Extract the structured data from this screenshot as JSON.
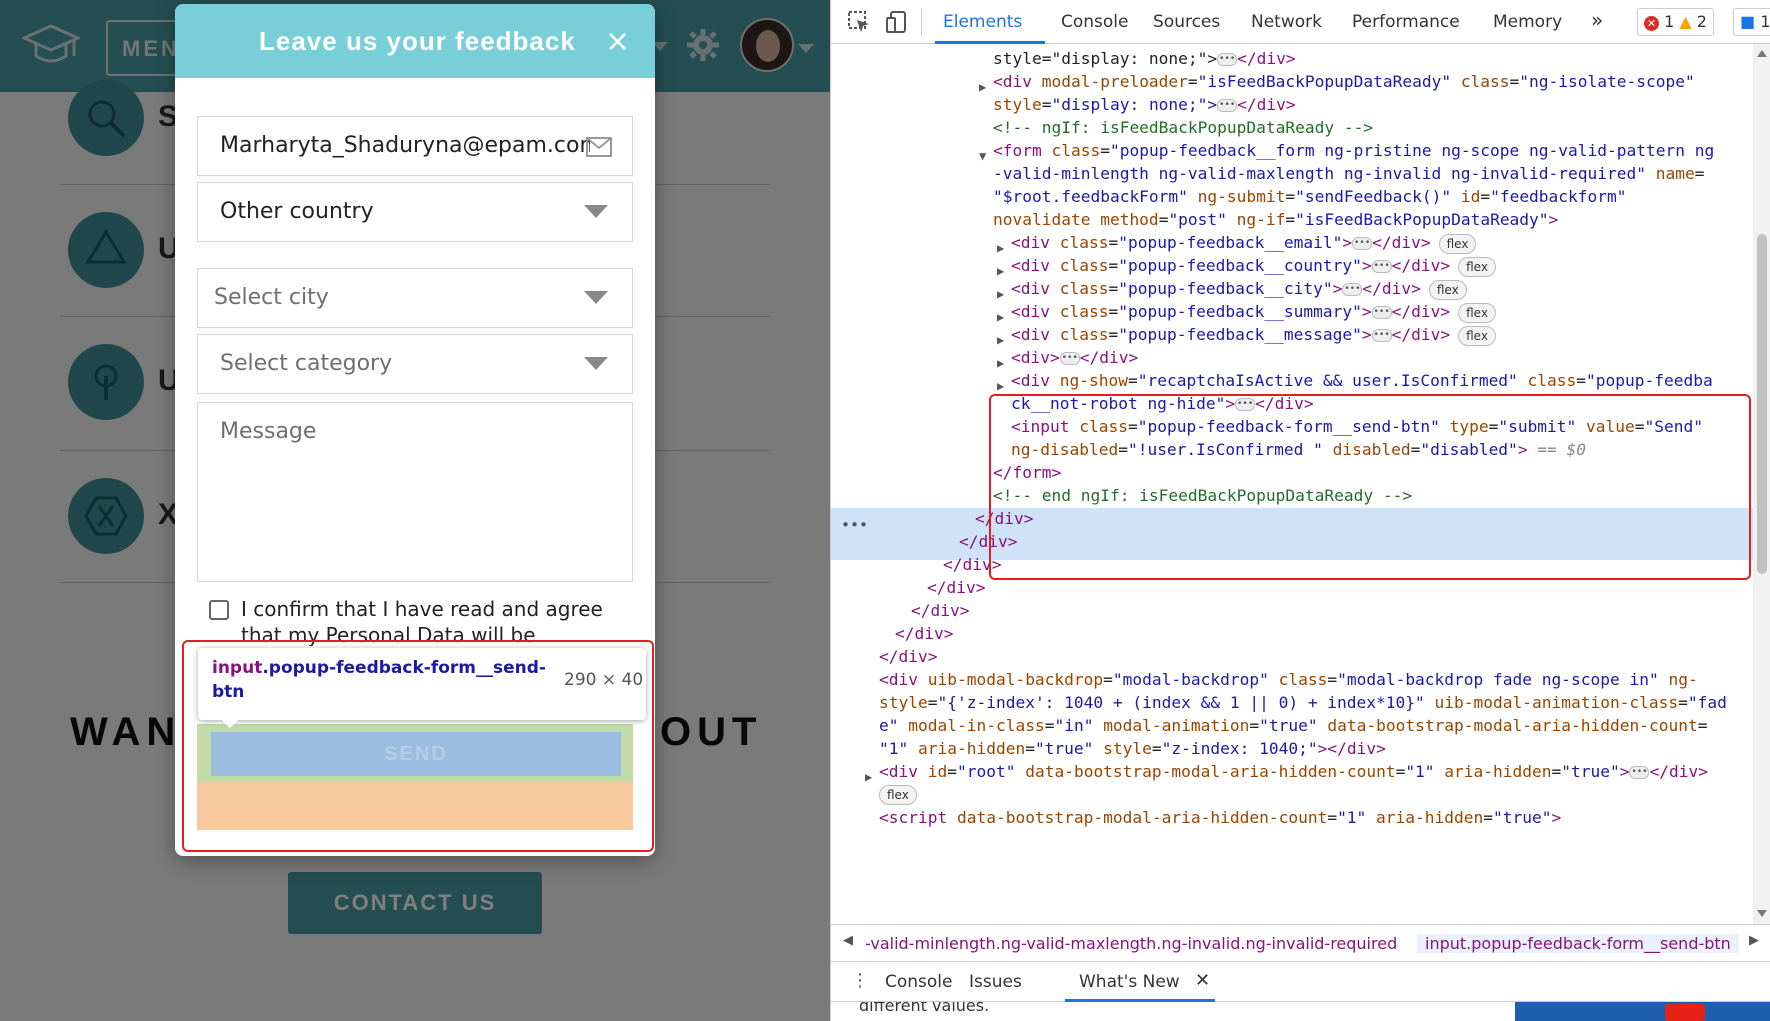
{
  "page": {
    "menu_label": "MEN",
    "service_letters": [
      "S",
      "U",
      "U",
      "X"
    ],
    "want_left": "WAN",
    "want_right": "OUT",
    "contact_label": "CONTACT US"
  },
  "modal": {
    "title": "Leave us your feedback",
    "close": "×",
    "email_value": "Marharyta_Shaduryna@epam.com",
    "country_value": "Other country",
    "city_placeholder": "Select city",
    "category_placeholder": "Select category",
    "message_placeholder": "Message",
    "confirm_text": "I confirm that I have read and agree that my Personal Data will be processed",
    "send_label": "SEND"
  },
  "tooltip": {
    "tag": "input",
    "cls": ".popup-feedback-form__send-btn",
    "dimensions": "290 × 40"
  },
  "devtools": {
    "tabs": [
      "Elements",
      "Console",
      "Sources",
      "Network",
      "Performance",
      "Memory"
    ],
    "more": "»",
    "errors": "1",
    "warnings": "2",
    "messages": "1",
    "breadcrumb1": "-valid-minlength.ng-valid-maxlength.ng-invalid.ng-invalid-required",
    "breadcrumb2": "input.popup-feedback-form__send-btn",
    "drawer_tabs": [
      "Console",
      "Issues",
      "What's New"
    ],
    "drawer_peek": "different values."
  },
  "dom_lines": [
    {
      "t": [
        [
          "tx",
          "style=\"display: none;\">"
        ],
        [
          "ell",
          ""
        ],
        [
          "tg",
          "</div>"
        ]
      ]
    },
    {
      "t": [
        [
          "tg",
          "<div "
        ],
        [
          "an",
          "modal-preloader"
        ],
        [
          "tx",
          "="
        ],
        [
          "av",
          "\"isFeedBackPopupDataReady\" "
        ],
        [
          "an",
          "class"
        ],
        [
          "tx",
          "="
        ],
        [
          "av",
          "\"ng-isolate-scope\""
        ]
      ]
    },
    {
      "t": [
        [
          "an",
          "style"
        ],
        [
          "tx",
          "="
        ],
        [
          "av",
          "\"display: none;\">"
        ],
        [
          "ell",
          ""
        ],
        [
          "tg",
          "</div>"
        ]
      ]
    },
    {
      "t": [
        [
          "cm",
          "<!-- ngIf: isFeedBackPopupDataReady -->"
        ]
      ]
    },
    {
      "t": [
        [
          "tg",
          "<form "
        ],
        [
          "an",
          "class"
        ],
        [
          "tx",
          "="
        ],
        [
          "av",
          "\"popup-feedback__form ng-pristine ng-scope ng-valid-pattern ng"
        ]
      ]
    },
    {
      "t": [
        [
          "av",
          "-valid-minlength ng-valid-maxlength ng-invalid ng-invalid-required\" "
        ],
        [
          "an",
          "name"
        ],
        [
          "tx",
          "="
        ]
      ]
    },
    {
      "t": [
        [
          "av",
          "\"$root.feedbackForm\" "
        ],
        [
          "an",
          "ng-submit"
        ],
        [
          "tx",
          "="
        ],
        [
          "av",
          "\"sendFeedback()\" "
        ],
        [
          "an",
          "id"
        ],
        [
          "tx",
          "="
        ],
        [
          "av",
          "\"feedbackform\""
        ]
      ]
    },
    {
      "t": [
        [
          "an",
          "novalidate "
        ],
        [
          "an",
          "method"
        ],
        [
          "tx",
          "="
        ],
        [
          "av",
          "\"post\" "
        ],
        [
          "an",
          "ng-if"
        ],
        [
          "tx",
          "="
        ],
        [
          "av",
          "\"isFeedBackPopupDataReady\""
        ],
        [
          "tg",
          ">"
        ]
      ]
    },
    {
      "t": [
        [
          "tg",
          "<div "
        ],
        [
          "an",
          "class"
        ],
        [
          "tx",
          "="
        ],
        [
          "av",
          "\"popup-feedback__email\""
        ],
        [
          "tg",
          ">"
        ],
        [
          "ell",
          ""
        ],
        [
          "tg",
          "</div>"
        ]
      ]
    },
    {
      "t": [
        [
          "tg",
          "<div "
        ],
        [
          "an",
          "class"
        ],
        [
          "tx",
          "="
        ],
        [
          "av",
          "\"popup-feedback__country\""
        ],
        [
          "tg",
          ">"
        ],
        [
          "ell",
          ""
        ],
        [
          "tg",
          "</div>"
        ]
      ]
    },
    {
      "t": [
        [
          "tg",
          "<div "
        ],
        [
          "an",
          "class"
        ],
        [
          "tx",
          "="
        ],
        [
          "av",
          "\"popup-feedback__city\""
        ],
        [
          "tg",
          ">"
        ],
        [
          "ell",
          ""
        ],
        [
          "tg",
          "</div>"
        ]
      ]
    },
    {
      "t": [
        [
          "tg",
          "<div "
        ],
        [
          "an",
          "class"
        ],
        [
          "tx",
          "="
        ],
        [
          "av",
          "\"popup-feedback__summary\""
        ],
        [
          "tg",
          ">"
        ],
        [
          "ell",
          ""
        ],
        [
          "tg",
          "</div>"
        ]
      ]
    },
    {
      "t": [
        [
          "tg",
          "<div "
        ],
        [
          "an",
          "class"
        ],
        [
          "tx",
          "="
        ],
        [
          "av",
          "\"popup-feedback__message\""
        ],
        [
          "tg",
          ">"
        ],
        [
          "ell",
          ""
        ],
        [
          "tg",
          "</div>"
        ]
      ]
    },
    {
      "t": [
        [
          "tg",
          "<div>"
        ],
        [
          "ell",
          ""
        ],
        [
          "tg",
          "</div>"
        ]
      ]
    },
    {
      "t": [
        [
          "tg",
          "<div "
        ],
        [
          "an",
          "ng-show"
        ],
        [
          "tx",
          "="
        ],
        [
          "av",
          "\"recaptchaIsActive && user.IsConfirmed\" "
        ],
        [
          "an",
          "class"
        ],
        [
          "tx",
          "="
        ],
        [
          "av",
          "\"popup-feedba"
        ]
      ]
    },
    {
      "t": [
        [
          "av",
          "ck__not-robot ng-hide\""
        ],
        [
          "tg",
          ">"
        ],
        [
          "ell",
          ""
        ],
        [
          "tg",
          "</div>"
        ]
      ]
    },
    {
      "t": [
        [
          "tg",
          "<input "
        ],
        [
          "an",
          "class"
        ],
        [
          "tx",
          "="
        ],
        [
          "av",
          "\"popup-feedback-form__send-btn\" "
        ],
        [
          "an",
          "type"
        ],
        [
          "tx",
          "="
        ],
        [
          "av",
          "\"submit\" "
        ],
        [
          "an",
          "value"
        ],
        [
          "tx",
          "="
        ],
        [
          "av",
          "\"Send\""
        ]
      ]
    },
    {
      "t": [
        [
          "an",
          "ng-disabled"
        ],
        [
          "tx",
          "="
        ],
        [
          "av",
          "\"!user.IsConfirmed \" "
        ],
        [
          "an",
          "disabled"
        ],
        [
          "tx",
          "="
        ],
        [
          "av",
          "\"disabled\""
        ],
        [
          "tg",
          ">"
        ],
        [
          "gr",
          " == $0"
        ]
      ]
    },
    {
      "t": [
        [
          "tg",
          "</form>"
        ]
      ]
    },
    {
      "t": [
        [
          "cm",
          "<!-- end ngIf: isFeedBackPopupDataReady -->"
        ]
      ]
    },
    {
      "t": [
        [
          "tg",
          "</div>"
        ]
      ]
    },
    {
      "t": [
        [
          "tg",
          "</div>"
        ]
      ]
    },
    {
      "t": [
        [
          "tg",
          "</div>"
        ]
      ]
    },
    {
      "t": [
        [
          "tg",
          "</div>"
        ]
      ]
    },
    {
      "t": [
        [
          "tg",
          "</div>"
        ]
      ]
    },
    {
      "t": [
        [
          "tg",
          "</div>"
        ]
      ]
    },
    {
      "t": [
        [
          "tg",
          "</div>"
        ]
      ]
    },
    {
      "t": [
        [
          "tg",
          "<div "
        ],
        [
          "an",
          "uib-modal-backdrop"
        ],
        [
          "tx",
          "="
        ],
        [
          "av",
          "\"modal-backdrop\" "
        ],
        [
          "an",
          "class"
        ],
        [
          "tx",
          "="
        ],
        [
          "av",
          "\"modal-backdrop fade ng-scope in\" "
        ],
        [
          "an",
          "ng-"
        ]
      ]
    },
    {
      "t": [
        [
          "an",
          "style"
        ],
        [
          "tx",
          "="
        ],
        [
          "av",
          "\"{'z-index': 1040 + (index && 1 || 0) + index*10}\" "
        ],
        [
          "an",
          "uib-modal-animation-class"
        ],
        [
          "tx",
          "="
        ],
        [
          "av",
          "\"fad"
        ]
      ]
    },
    {
      "t": [
        [
          "av",
          "e\" "
        ],
        [
          "an",
          "modal-in-class"
        ],
        [
          "tx",
          "="
        ],
        [
          "av",
          "\"in\" "
        ],
        [
          "an",
          "modal-animation"
        ],
        [
          "tx",
          "="
        ],
        [
          "av",
          "\"true\" "
        ],
        [
          "an",
          "data-bootstrap-modal-aria-hidden-count"
        ],
        [
          "tx",
          "="
        ]
      ]
    },
    {
      "t": [
        [
          "av",
          "\"1\" "
        ],
        [
          "an",
          "aria-hidden"
        ],
        [
          "tx",
          "="
        ],
        [
          "av",
          "\"true\" "
        ],
        [
          "an",
          "style"
        ],
        [
          "tx",
          "="
        ],
        [
          "av",
          "\"z-index: 1040;\""
        ],
        [
          "tg",
          "></div>"
        ]
      ]
    },
    {
      "t": [
        [
          "tg",
          "<div "
        ],
        [
          "an",
          "id"
        ],
        [
          "tx",
          "="
        ],
        [
          "av",
          "\"root\" "
        ],
        [
          "an",
          "data-bootstrap-modal-aria-hidden-count"
        ],
        [
          "tx",
          "="
        ],
        [
          "av",
          "\"1\" "
        ],
        [
          "an",
          "aria-hidden"
        ],
        [
          "tx",
          "="
        ],
        [
          "av",
          "\"true\""
        ],
        [
          "tg",
          ">"
        ],
        [
          "ell",
          ""
        ],
        [
          "tg",
          "</div>"
        ]
      ]
    },
    {
      "t": []
    },
    {
      "t": [
        [
          "tg",
          "<script "
        ],
        [
          "an",
          "data-bootstrap-modal-aria-hidden-count"
        ],
        [
          "tx",
          "="
        ],
        [
          "av",
          "\"1\" "
        ],
        [
          "an",
          "aria-hidden"
        ],
        [
          "tx",
          "="
        ],
        [
          "av",
          "\"true\""
        ],
        [
          "tg",
          ">"
        ]
      ]
    }
  ],
  "flex_badge": "flex"
}
